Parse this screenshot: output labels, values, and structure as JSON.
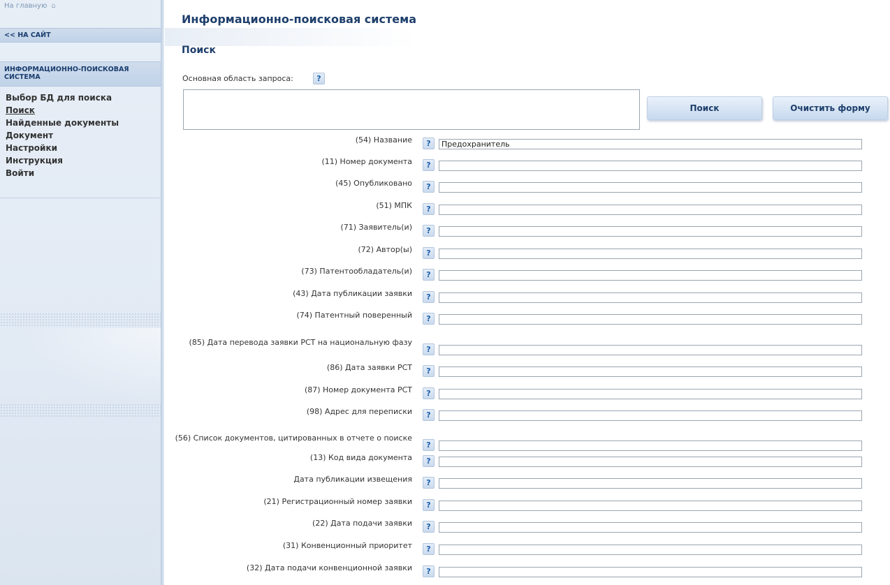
{
  "sidebar": {
    "home_link": "На главную",
    "to_site": "<< НА САЙТ",
    "system_title": "ИНФОРМАЦИОННО-ПОИСКОВАЯ СИСТЕМА",
    "nav": [
      {
        "label": "Выбор БД для поиска",
        "active": false
      },
      {
        "label": "Поиск",
        "active": true
      },
      {
        "label": "Найденные документы",
        "active": false
      },
      {
        "label": "Документ",
        "active": false
      },
      {
        "label": "Настройки",
        "active": false
      },
      {
        "label": "Инструкция",
        "active": false
      },
      {
        "label": "Войти",
        "active": false
      }
    ]
  },
  "main": {
    "title": "Информационно-поисковая система",
    "section_title": "Поиск",
    "query_label": "Основная область запроса:",
    "help_glyph": "?",
    "query_value": "",
    "search_button": "Поиск",
    "clear_button": "Очистить форму"
  },
  "fields": [
    {
      "label": "(54) Название",
      "value": "Предохранитель"
    },
    {
      "label": "(11) Номер документа",
      "value": ""
    },
    {
      "label": "(45) Опубликовано",
      "value": ""
    },
    {
      "label": "(51) МПК",
      "value": ""
    },
    {
      "label": "(71) Заявитель(и)",
      "value": ""
    },
    {
      "label": "(72) Автор(ы)",
      "value": ""
    },
    {
      "label": "(73) Патентообладатель(и)",
      "value": ""
    },
    {
      "label": "(43) Дата публикации заявки",
      "value": ""
    },
    {
      "label": "(74) Патентный поверенный",
      "value": ""
    },
    {
      "label": "(85) Дата перевода заявки PCT на национальную фазу",
      "value": ""
    },
    {
      "label": "(86) Дата заявки PCT",
      "value": ""
    },
    {
      "label": "(87) Номер документа PCT",
      "value": ""
    },
    {
      "label": "(98) Адрес для переписки",
      "value": ""
    },
    {
      "label": "(56) Список документов, цитированных в отчете о поиске",
      "value": ""
    },
    {
      "label": "(13) Код вида документа",
      "value": ""
    },
    {
      "label": "Дата публикации извещения",
      "value": ""
    },
    {
      "label": "(21) Регистрационный номер заявки",
      "value": ""
    },
    {
      "label": "(22) Дата подачи заявки",
      "value": ""
    },
    {
      "label": "(31) Конвенционный приоритет",
      "value": ""
    },
    {
      "label": "(32) Дата подачи конвенционной заявки",
      "value": ""
    }
  ],
  "colors": {
    "title": "#1e3f6c",
    "sidebar_bg": "#e2eaf4",
    "help_icon": "#1a5fab"
  }
}
